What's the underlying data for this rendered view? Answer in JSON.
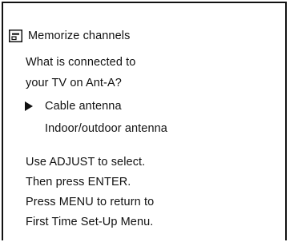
{
  "menu": {
    "title": "Memorize channels",
    "title_icon": "memory-icon",
    "question_line1": "What is connected to",
    "question_line2": "your TV on Ant-A?",
    "options": [
      {
        "label": "Cable antenna",
        "selected": true
      },
      {
        "label": "Indoor/outdoor antenna",
        "selected": false
      }
    ],
    "instructions": [
      "Use ADJUST to select.",
      "Then press ENTER.",
      "Press MENU to return to",
      "First Time Set-Up Menu."
    ]
  },
  "colors": {
    "foreground": "#111111",
    "background": "#ffffff"
  }
}
